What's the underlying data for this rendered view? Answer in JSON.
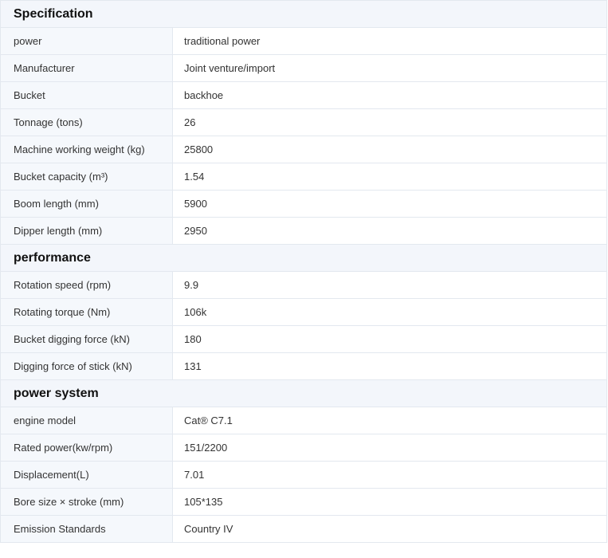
{
  "sections": [
    {
      "title": "Specification",
      "rows": [
        {
          "label": "power",
          "value": "traditional power"
        },
        {
          "label": "Manufacturer",
          "value": "Joint venture/import"
        },
        {
          "label": "Bucket",
          "value": "backhoe"
        },
        {
          "label": "Tonnage (tons)",
          "value": "26"
        },
        {
          "label": "Machine working weight (kg)",
          "value": "25800"
        },
        {
          "label": "Bucket capacity (m³)",
          "value": "1.54"
        },
        {
          "label": "Boom length (mm)",
          "value": "5900"
        },
        {
          "label": "Dipper length (mm)",
          "value": "2950"
        }
      ]
    },
    {
      "title": "performance",
      "rows": [
        {
          "label": "Rotation speed (rpm)",
          "value": "9.9"
        },
        {
          "label": "Rotating torque (Nm)",
          "value": "106k"
        },
        {
          "label": "Bucket digging force (kN)",
          "value": "180"
        },
        {
          "label": "Digging force of stick (kN)",
          "value": "131"
        }
      ]
    },
    {
      "title": "power system",
      "rows": [
        {
          "label": "engine model",
          "value": "Cat® C7.1"
        },
        {
          "label": "Rated power(kw/rpm)",
          "value": "151/2200"
        },
        {
          "label": "Displacement(L)",
          "value": "7.01"
        },
        {
          "label": "Bore size × stroke (mm)",
          "value": "105*135"
        },
        {
          "label": "Emission Standards",
          "value": "Country IV"
        }
      ]
    }
  ]
}
